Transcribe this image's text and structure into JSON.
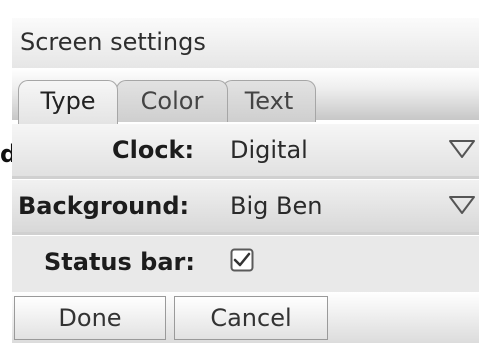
{
  "window": {
    "title": "Screen settings"
  },
  "tabs": [
    {
      "label": "Type",
      "active": true
    },
    {
      "label": "Color",
      "active": false
    },
    {
      "label": "Text",
      "active": false
    }
  ],
  "left_edge_glyph": "d",
  "settings": {
    "clock": {
      "label": "Clock:",
      "value": "Digital"
    },
    "background": {
      "label": "Background:",
      "value": "Big Ben"
    },
    "status_bar": {
      "label": "Status bar:",
      "checked": true
    }
  },
  "buttons": {
    "done": "Done",
    "cancel": "Cancel"
  },
  "colors": {
    "text": "#2a2a2a",
    "tab_border": "#a6a6a6",
    "button_border": "#9a9a9a"
  },
  "icons": {
    "dropdown": "triangle-down-icon",
    "checkbox": "checkmark-icon"
  }
}
